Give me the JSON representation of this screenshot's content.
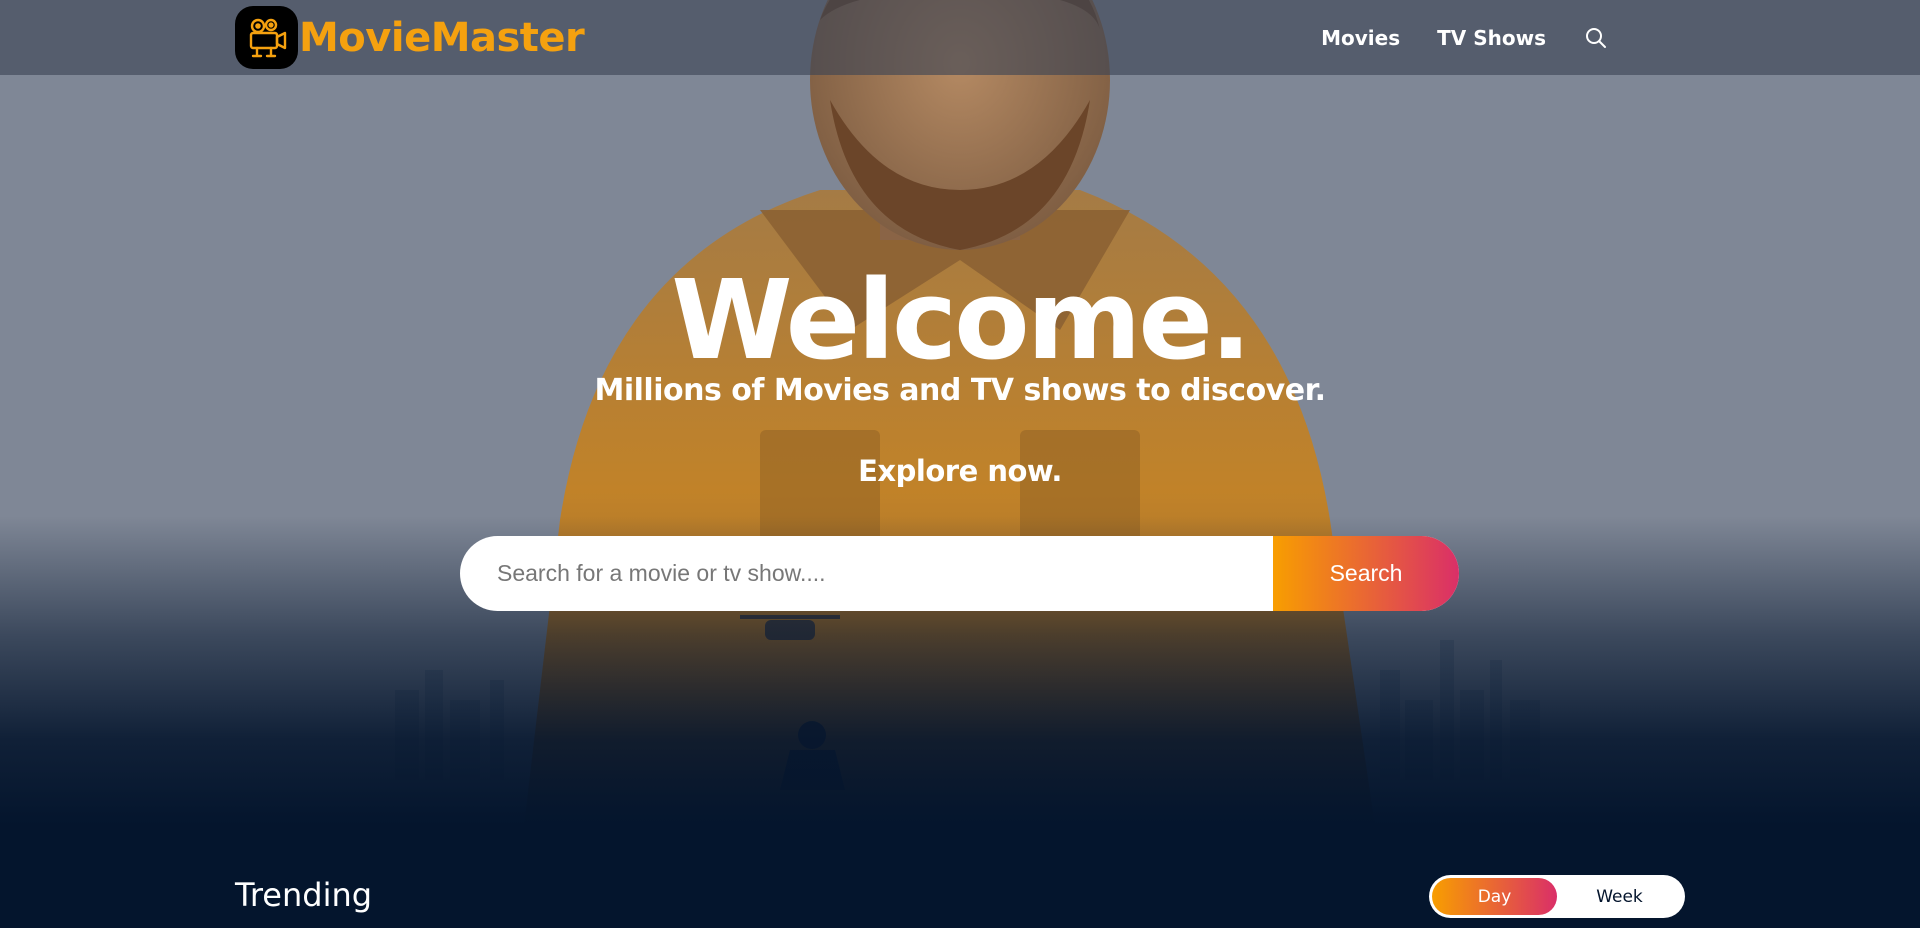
{
  "header": {
    "logo_text": "MovieMaster",
    "logo_icon": "film-camera-icon",
    "nav": [
      {
        "label": "Movies"
      },
      {
        "label": "TV Shows"
      }
    ],
    "search_icon": "search-icon"
  },
  "hero": {
    "title": "Welcome.",
    "subtitle": "Millions of Movies and TV shows to discover.",
    "explore": "Explore now.",
    "search_placeholder": "Search for a movie or tv show....",
    "search_button": "Search"
  },
  "trending": {
    "title": "Trending",
    "tabs": [
      {
        "label": "Day",
        "active": true
      },
      {
        "label": "Week",
        "active": false
      }
    ]
  },
  "colors": {
    "accent_orange": "#f89e00",
    "accent_pink": "#da2f68",
    "logo": "#f5a10f",
    "background": "#04152d"
  }
}
